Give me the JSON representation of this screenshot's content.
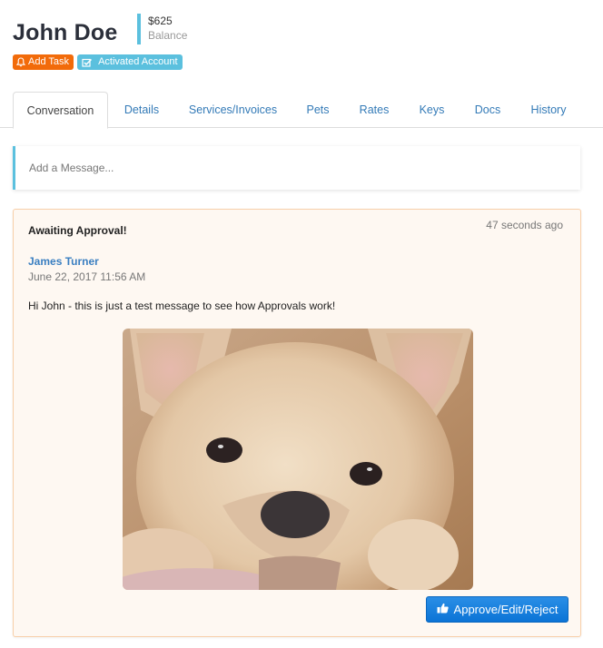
{
  "customer": {
    "name": "John Doe",
    "balance_amount": "$625",
    "balance_label": "Balance"
  },
  "labels": {
    "add_task": {
      "text": "Add Task",
      "icon": "bell-icon",
      "color": "#f26b0a"
    },
    "account_status": {
      "text": "Activated Account",
      "icon": "checkbox-check-icon",
      "color": "#5bc0de"
    }
  },
  "tabs": [
    {
      "label": "Conversation",
      "active": true
    },
    {
      "label": "Details",
      "active": false
    },
    {
      "label": "Services/Invoices",
      "active": false
    },
    {
      "label": "Pets",
      "active": false
    },
    {
      "label": "Rates",
      "active": false
    },
    {
      "label": "Keys",
      "active": false
    },
    {
      "label": "Docs",
      "active": false
    },
    {
      "label": "History",
      "active": false
    }
  ],
  "composer": {
    "placeholder": "Add a Message...",
    "value": ""
  },
  "message": {
    "status_title": "Awaiting Approval!",
    "relative_time": "47 seconds ago",
    "author": "James Turner",
    "date": "June 22, 2017 11:56 AM",
    "body": "Hi John - this is just a test message to see how Approvals work!",
    "attachment_alt": "French bulldog puppy photo",
    "action_button": {
      "label": "Approve/Edit/Reject",
      "icon": "thumbs-up-icon"
    }
  },
  "colors": {
    "accent_blue": "#5bc0de",
    "link_blue": "#337ab7",
    "warning_orange": "#f26b0a",
    "card_bg": "#fef8f2",
    "card_border": "#f8cfa9",
    "primary_button": "#1a82dd"
  }
}
